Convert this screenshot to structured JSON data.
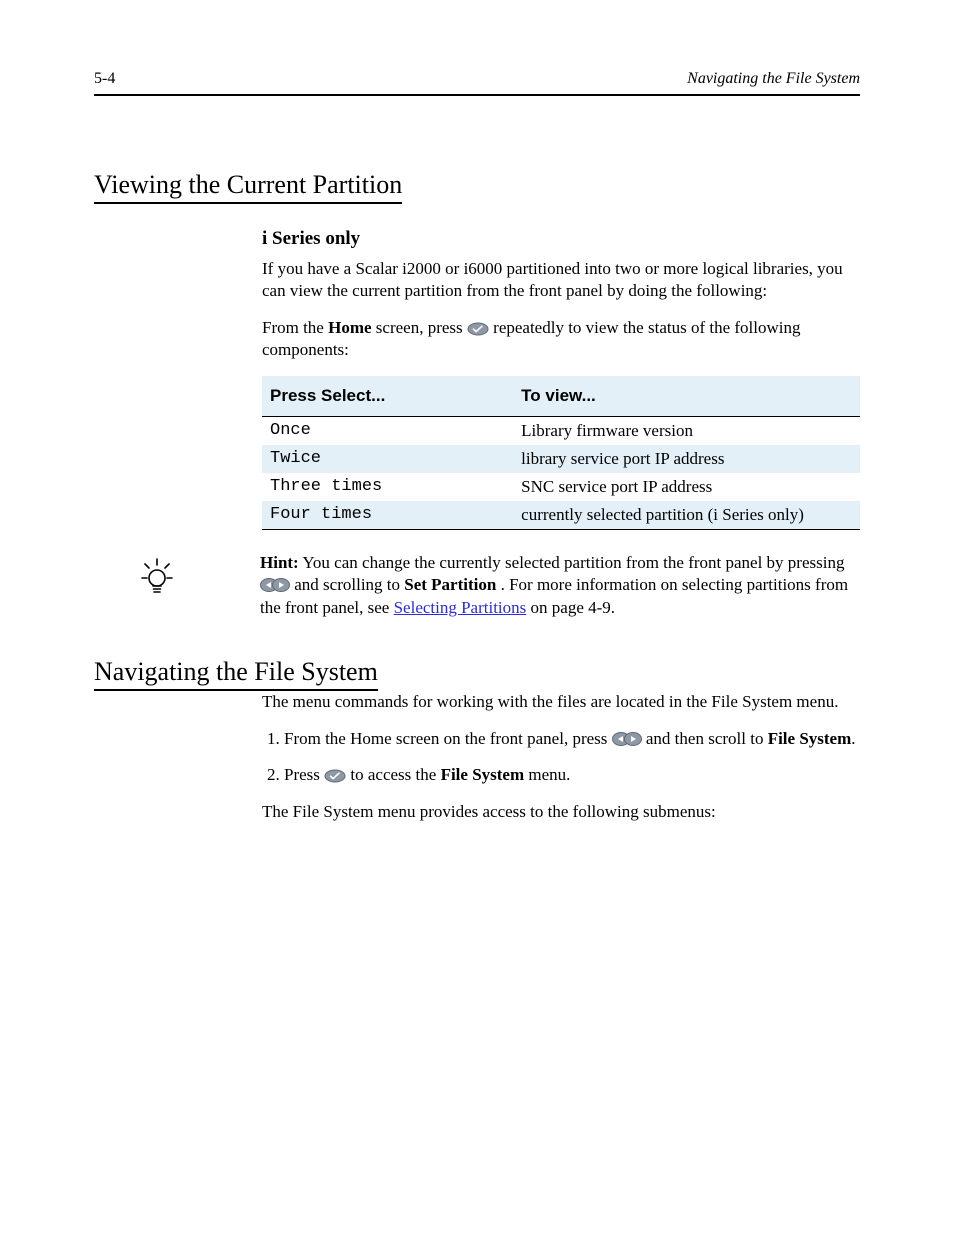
{
  "header": {
    "left": "5-4",
    "right": "Navigating the File System"
  },
  "section_title": "Viewing the Current Partition",
  "sub": "i Series only",
  "intro_para": "If you have a Scalar i2000 or i6000 partitioned into two or more logical libraries, you can view the current partition from the front panel by doing the following:",
  "step1_prefix": "From the",
  "step1_home": "Home",
  "step1_mid": "screen, press",
  "step1_post": "repeatedly to view the status of the following components:",
  "table": {
    "heads": [
      "Press Select...",
      "To view..."
    ],
    "rows": [
      {
        "k": "Once",
        "v": "Library firmware version"
      },
      {
        "k": "Twice",
        "v": "library service port IP address"
      },
      {
        "k": "Three times",
        "v": "SNC service port IP address"
      },
      {
        "k": "Four times",
        "v": "currently selected partition (i Series only)"
      }
    ]
  },
  "hint": {
    "lead": "Hint:",
    "part1": "You can change the currently selected partition from the front panel by pressing",
    "part2": "and scrolling to",
    "part2_bold": "Set Partition",
    "part3": ". For more information on selecting partitions from the front panel, see",
    "link": "Selecting Partitions",
    "after_link": "on page 4-9."
  },
  "nav": {
    "heading": "Navigating the File System",
    "p1": "The menu commands for working with the files are located in the File System menu.",
    "s1a": "From the Home screen on the front panel, press",
    "s1b": "and then scroll to",
    "s2a": "Press",
    "s2b": "to access the",
    "s2c": "menu.",
    "file_system": "File System",
    "p_end": "The File System menu provides access to the following submenus:"
  }
}
